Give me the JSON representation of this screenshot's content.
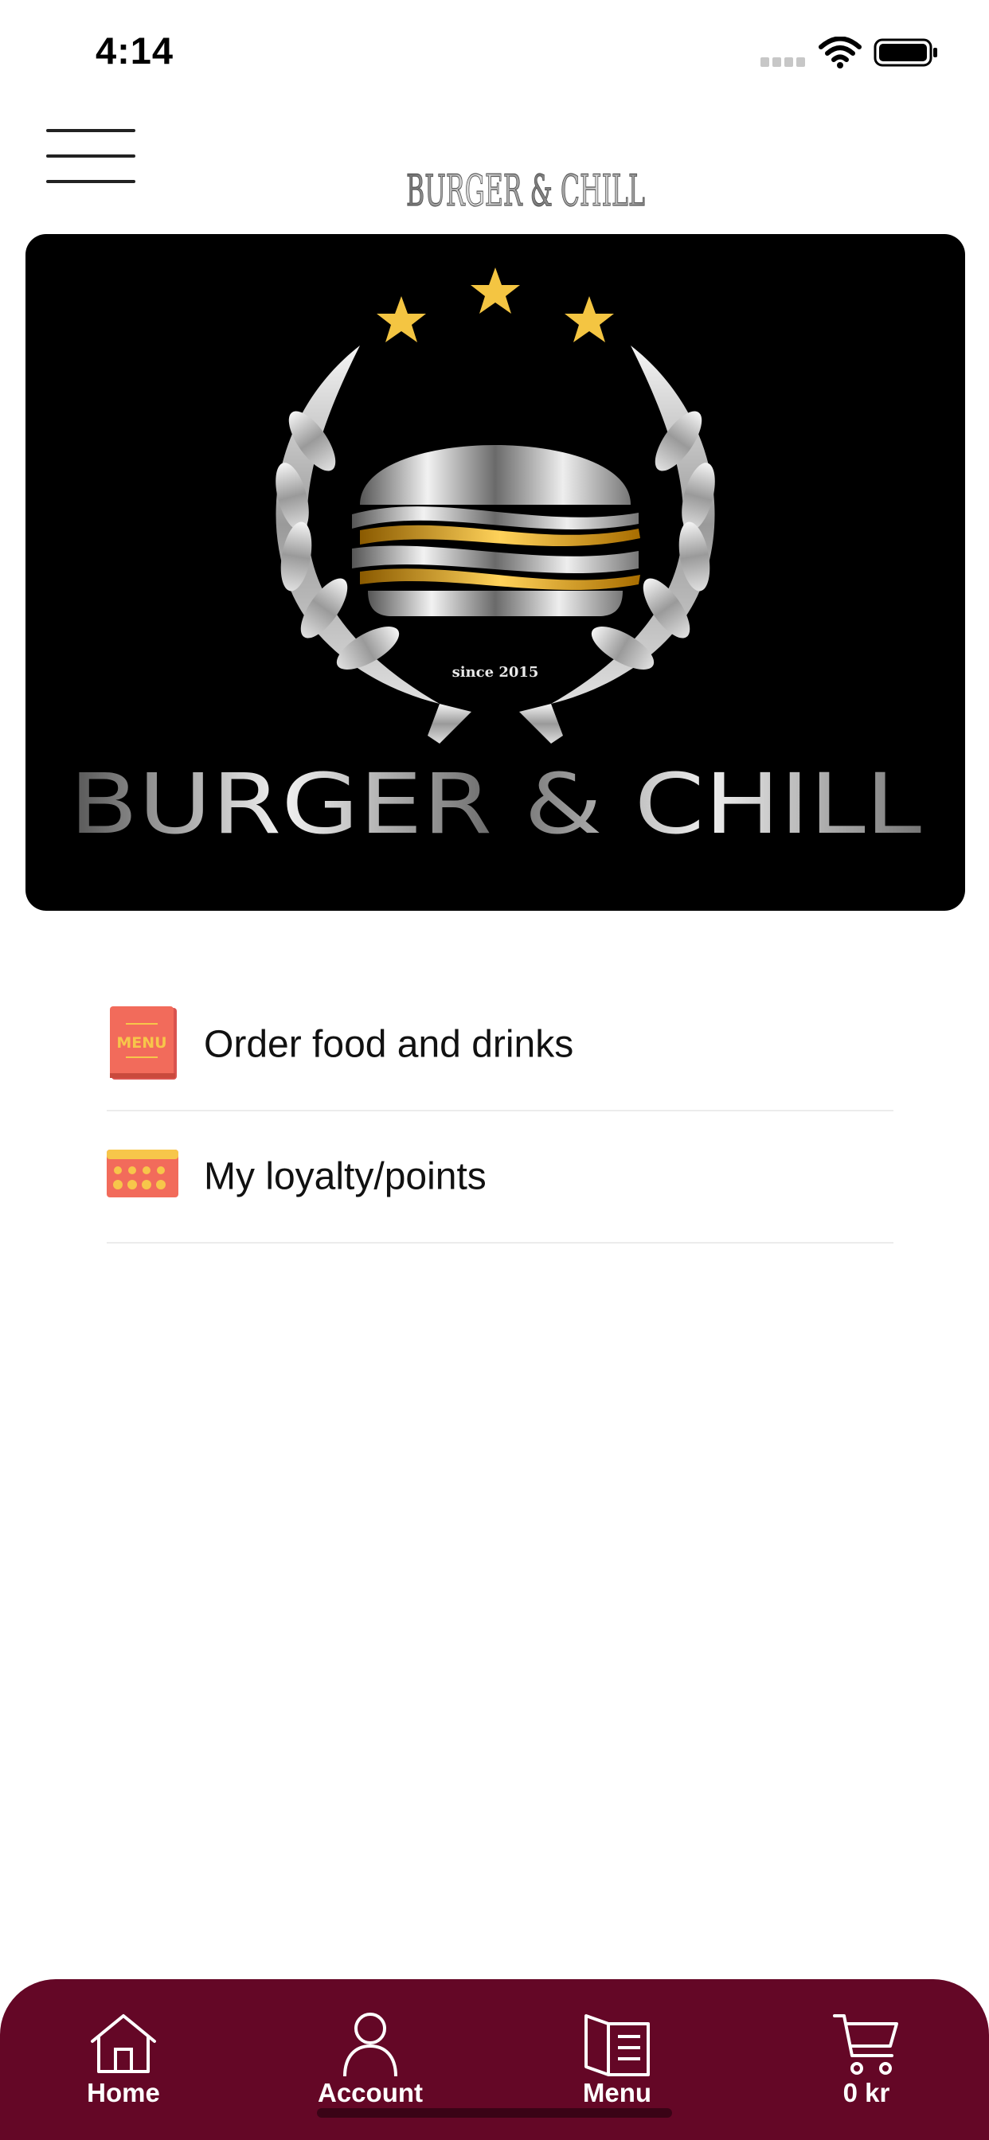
{
  "status_bar": {
    "time": "4:14",
    "icons": [
      "signal-icon",
      "wifi-icon",
      "battery-icon"
    ]
  },
  "nav": {
    "menu_icon": "hamburger-menu-icon",
    "logo_text": "BURGER & CHILL"
  },
  "hero": {
    "brand_text": "BURGER & CHILL",
    "since_text": "since 2015"
  },
  "actions": [
    {
      "label": "Order food and drinks",
      "icon": "menu-book-icon",
      "icon_text": "MENU"
    },
    {
      "label": "My loyalty/points",
      "icon": "loyalty-card-icon"
    }
  ],
  "tab_bar": {
    "tabs": [
      {
        "label": "Home",
        "icon": "home-icon"
      },
      {
        "label": "Account",
        "icon": "account-icon"
      },
      {
        "label": "Menu",
        "icon": "menu-icon"
      },
      {
        "label": "0 kr",
        "icon": "cart-icon"
      }
    ]
  },
  "colors": {
    "tab_bar_background": "#640726",
    "hero_background": "#000000",
    "icon_accent": "#f26b5b",
    "icon_yellow": "#f7c64a"
  }
}
